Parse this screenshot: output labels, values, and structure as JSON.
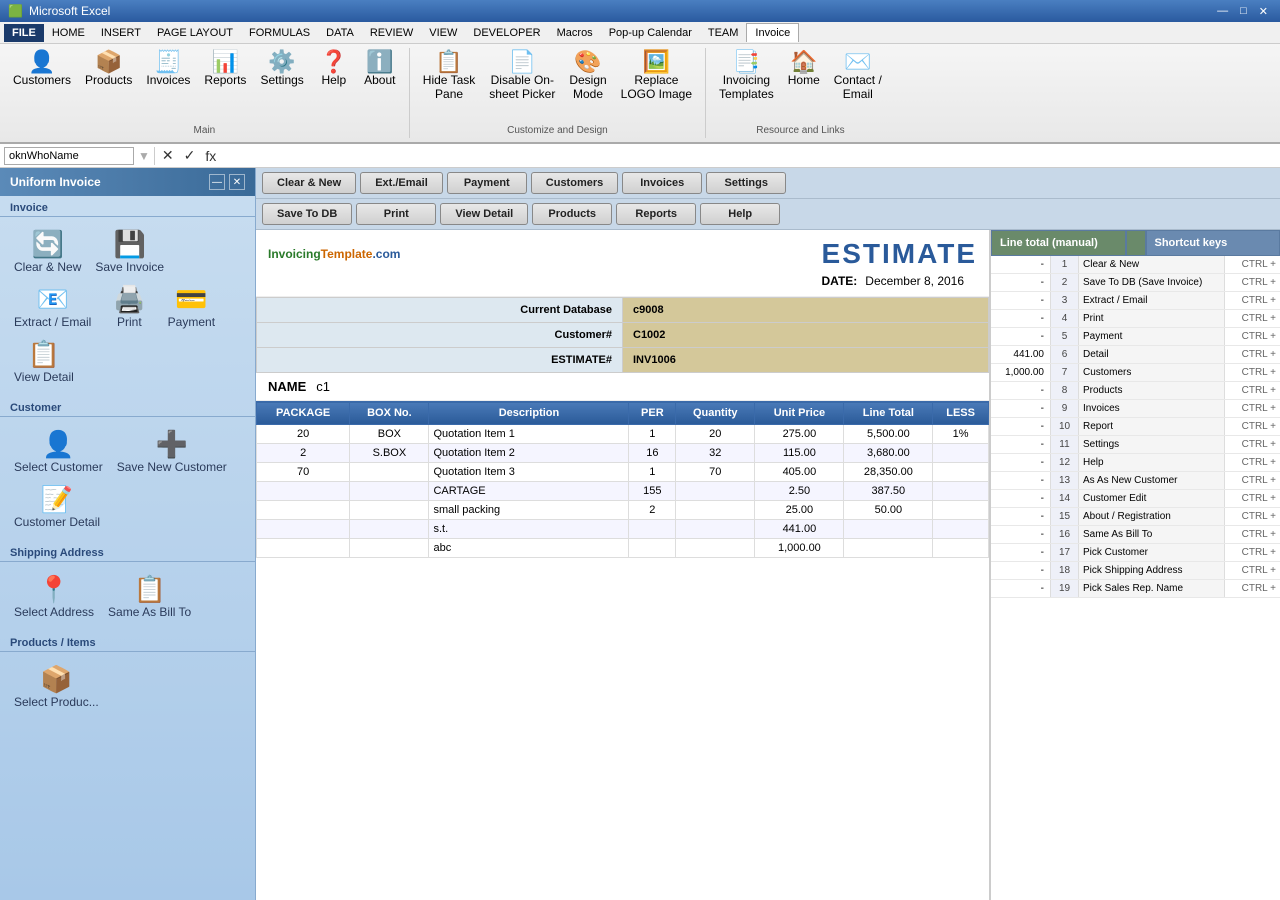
{
  "titlebar": {
    "app_name": "Microsoft Excel",
    "controls": [
      "—",
      "□",
      "✕"
    ]
  },
  "menutabs": {
    "tabs": [
      "FILE",
      "HOME",
      "INSERT",
      "PAGE LAYOUT",
      "FORMULAS",
      "DATA",
      "REVIEW",
      "VIEW",
      "DEVELOPER",
      "Macros",
      "Pop-up Calendar",
      "TEAM",
      "Invoice"
    ],
    "active": "Invoice"
  },
  "ribbon": {
    "groups": [
      {
        "label": "Main",
        "buttons": [
          {
            "icon": "👤",
            "label": "Customers"
          },
          {
            "icon": "📦",
            "label": "Products"
          },
          {
            "icon": "🧾",
            "label": "Invoices"
          },
          {
            "icon": "📊",
            "label": "Reports"
          },
          {
            "icon": "⚙️",
            "label": "Settings"
          },
          {
            "icon": "❓",
            "label": "Help"
          },
          {
            "icon": "ℹ️",
            "label": "About"
          }
        ]
      },
      {
        "label": "Customize and Design",
        "buttons": [
          {
            "icon": "📋",
            "label": "Hide Task Pane"
          },
          {
            "icon": "📄",
            "label": "Disable On-sheet Picker"
          },
          {
            "icon": "🎨",
            "label": "Design Mode"
          },
          {
            "icon": "🖼️",
            "label": "Replace LOGO Image"
          }
        ]
      },
      {
        "label": "Resource and Links",
        "buttons": [
          {
            "icon": "📑",
            "label": "Invoicing Templates"
          },
          {
            "icon": "🏠",
            "label": "Home"
          },
          {
            "icon": "✉️",
            "label": "Contact / Email"
          }
        ]
      }
    ]
  },
  "formulabar": {
    "name_box": "oknWhoName",
    "value": ""
  },
  "sidebar": {
    "title": "Uniform Invoice",
    "sections": [
      {
        "label": "Invoice",
        "buttons": [
          {
            "icon": "🔄",
            "label": "Clear & New"
          },
          {
            "icon": "💾",
            "label": "Save Invoice"
          },
          {
            "icon": "📧",
            "label": "Extract / Email"
          }
        ]
      },
      {
        "label": "",
        "buttons": [
          {
            "icon": "🖨️",
            "label": "Print"
          },
          {
            "icon": "💳",
            "label": "Payment"
          },
          {
            "icon": "📋",
            "label": "View Detail"
          }
        ]
      },
      {
        "label": "Customer",
        "buttons": [
          {
            "icon": "👤",
            "label": "Select Customer"
          },
          {
            "icon": "➕",
            "label": "Save New Customer"
          },
          {
            "icon": "📝",
            "label": "Customer Detail"
          }
        ]
      },
      {
        "label": "Shipping Address",
        "buttons": [
          {
            "icon": "📍",
            "label": "Select Address"
          },
          {
            "icon": "📋",
            "label": "Same As Bill To"
          }
        ]
      },
      {
        "label": "Products / Items",
        "buttons": [
          {
            "icon": "📦",
            "label": "Select Produc..."
          }
        ]
      }
    ]
  },
  "action_buttons": {
    "row1": [
      "Clear & New",
      "Ext./Email",
      "Payment",
      "Customers",
      "Invoices",
      "Settings"
    ],
    "row2": [
      "Save To DB",
      "Print",
      "View Detail",
      "Products",
      "Reports",
      "Help"
    ]
  },
  "invoice": {
    "logo": "InvoicingTemplate.com",
    "title": "ESTIMATE",
    "date_label": "DATE:",
    "date_value": "December 8, 2016",
    "name_label": "NAME",
    "name_value": "c1",
    "current_db_label": "Current Database",
    "current_db_value": "c9008",
    "customer_num_label": "Customer#",
    "customer_num_value": "C1002",
    "estimate_num_label": "ESTIMATE#",
    "estimate_num_value": "INV1006",
    "table_headers": [
      "PACKAGE",
      "BOX No.",
      "Description",
      "PER",
      "Quantity",
      "Unit Price",
      "Line Total",
      "LESS"
    ],
    "items": [
      {
        "package": "20",
        "box": "BOX",
        "description": "Quotation Item 1",
        "per": "1",
        "quantity": "20",
        "unit_price": "275.00",
        "line_total": "5,500.00",
        "less": "1%"
      },
      {
        "package": "2",
        "box": "S.BOX",
        "description": "Quotation Item 2",
        "per": "16",
        "quantity": "32",
        "unit_price": "115.00",
        "line_total": "3,680.00",
        "less": ""
      },
      {
        "package": "70",
        "box": "",
        "description": "Quotation Item 3",
        "per": "1",
        "quantity": "70",
        "unit_price": "405.00",
        "line_total": "28,350.00",
        "less": ""
      },
      {
        "package": "",
        "box": "",
        "description": "CARTAGE",
        "per": "155",
        "quantity": "",
        "unit_price": "2.50",
        "line_total": "387.50",
        "less": ""
      },
      {
        "package": "",
        "box": "",
        "description": "small packing",
        "per": "2",
        "quantity": "",
        "unit_price": "25.00",
        "line_total": "50.00",
        "less": ""
      },
      {
        "package": "",
        "box": "",
        "description": "s.t.",
        "per": "",
        "quantity": "",
        "unit_price": "441.00",
        "line_total": "",
        "less": ""
      },
      {
        "package": "",
        "box": "",
        "description": "abc",
        "per": "",
        "quantity": "",
        "unit_price": "1,000.00",
        "line_total": "",
        "less": ""
      }
    ],
    "manual_totals": {
      "rows": [
        "-",
        "-",
        "-",
        "-",
        "-",
        "441.00",
        "1,000.00",
        "-",
        "-",
        "-",
        "-",
        "-",
        "-",
        "-",
        "-",
        "-",
        "-",
        "-",
        "-"
      ]
    }
  },
  "shortcut_panel": {
    "headers": [
      "Line total (manual)",
      "",
      "Shortcut keys"
    ],
    "items": [
      {
        "num": "1",
        "name": "Clear & New",
        "key": "CTRL +"
      },
      {
        "num": "2",
        "name": "Save To DB (Save Invoice)",
        "key": "CTRL +"
      },
      {
        "num": "3",
        "name": "Extract / Email",
        "key": "CTRL +"
      },
      {
        "num": "4",
        "name": "Print",
        "key": "CTRL +"
      },
      {
        "num": "5",
        "name": "Payment",
        "key": "CTRL +"
      },
      {
        "num": "6",
        "name": "Detail",
        "key": "CTRL +"
      },
      {
        "num": "7",
        "name": "Customers",
        "key": "CTRL +"
      },
      {
        "num": "8",
        "name": "Products",
        "key": "CTRL +"
      },
      {
        "num": "9",
        "name": "Invoices",
        "key": "CTRL +"
      },
      {
        "num": "10",
        "name": "Report",
        "key": "CTRL +"
      },
      {
        "num": "11",
        "name": "Settings",
        "key": "CTRL +"
      },
      {
        "num": "12",
        "name": "Help",
        "key": "CTRL +"
      },
      {
        "num": "13",
        "name": "As As New Customer",
        "key": "CTRL +"
      },
      {
        "num": "14",
        "name": "Customer Edit",
        "key": "CTRL +"
      },
      {
        "num": "15",
        "name": "About / Registration",
        "key": "CTRL +"
      },
      {
        "num": "16",
        "name": "Same As Bill To",
        "key": "CTRL +"
      },
      {
        "num": "17",
        "name": "Pick Customer",
        "key": "CTRL +"
      },
      {
        "num": "18",
        "name": "Pick Shipping Address",
        "key": "CTRL +"
      },
      {
        "num": "19",
        "name": "Pick Sales Rep. Name",
        "key": "CTRL +"
      }
    ]
  }
}
